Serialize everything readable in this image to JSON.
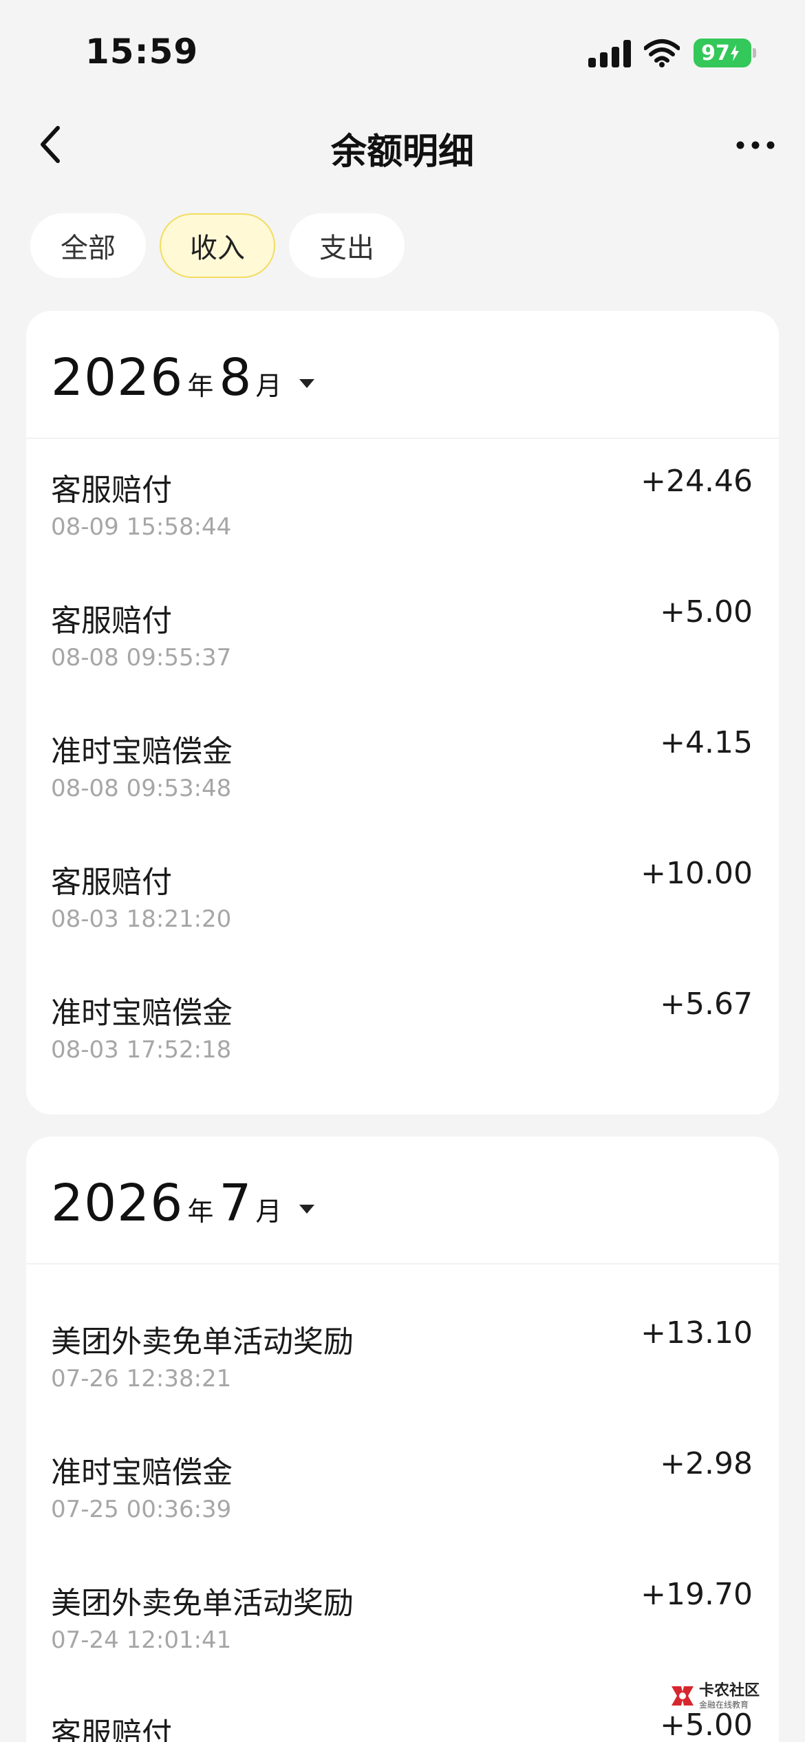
{
  "status_bar": {
    "time": "15:59",
    "battery": "97",
    "signal_icon": "signal-bars-icon",
    "wifi_icon": "wifi-icon",
    "battery_icon": "battery-charging-icon"
  },
  "nav": {
    "title": "余额明细",
    "back_icon": "chevron-left-icon",
    "more_icon": "more-dots-icon"
  },
  "filters": [
    {
      "label": "全部",
      "active": false
    },
    {
      "label": "收入",
      "active": true
    },
    {
      "label": "支出",
      "active": false
    }
  ],
  "months": [
    {
      "year": "2026",
      "year_unit": "年",
      "month": "8",
      "month_unit": "月",
      "transactions": [
        {
          "title": "客服赔付",
          "time": "08-09 15:58:44",
          "amount": "+24.46"
        },
        {
          "title": "客服赔付",
          "time": "08-08 09:55:37",
          "amount": "+5.00"
        },
        {
          "title": "准时宝赔偿金",
          "time": "08-08 09:53:48",
          "amount": "+4.15"
        },
        {
          "title": "客服赔付",
          "time": "08-03 18:21:20",
          "amount": "+10.00"
        },
        {
          "title": "准时宝赔偿金",
          "time": "08-03 17:52:18",
          "amount": "+5.67"
        }
      ]
    },
    {
      "year": "2026",
      "year_unit": "年",
      "month": "7",
      "month_unit": "月",
      "transactions": [
        {
          "title": "美团外卖免单活动奖励",
          "time": "07-26 12:38:21",
          "amount": "+13.10"
        },
        {
          "title": "准时宝赔偿金",
          "time": "07-25 00:36:39",
          "amount": "+2.98"
        },
        {
          "title": "美团外卖免单活动奖励",
          "time": "07-24 12:01:41",
          "amount": "+19.70"
        },
        {
          "title": "客服赔付",
          "time": "",
          "amount": "+5.00"
        }
      ]
    }
  ],
  "watermark": {
    "name": "卡农社区",
    "subtitle": "金融在线教育",
    "logo_color": "#d7262e"
  },
  "colors": {
    "background": "#f4f4f4",
    "active_tab_bg": "#fff9d6",
    "active_tab_border": "#f3dc5e",
    "battery_green": "#34c759",
    "secondary_text": "#a6a6a6"
  }
}
